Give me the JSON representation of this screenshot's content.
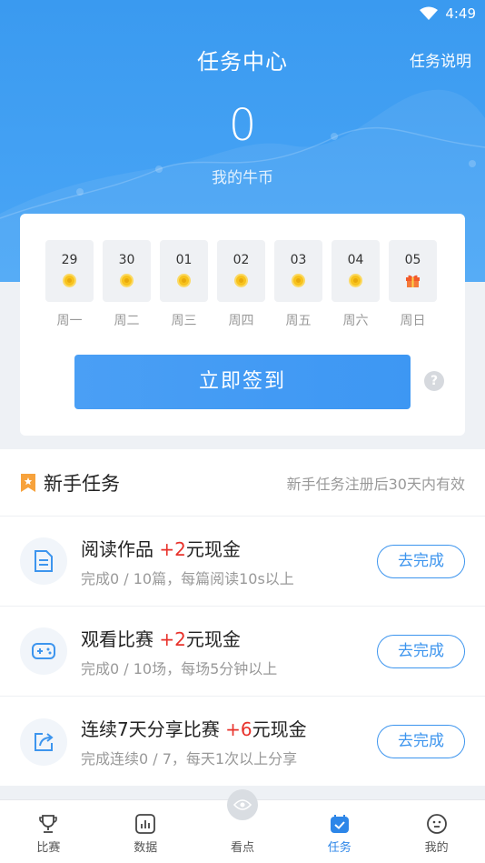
{
  "status_bar": {
    "time": "4:49"
  },
  "header": {
    "title": "任务中心",
    "task_desc_link": "任务说明",
    "coin_value": "0",
    "coin_label": "我的牛币"
  },
  "checkin": {
    "days": [
      {
        "num": "29",
        "weekday": "周一",
        "reward": "coin"
      },
      {
        "num": "30",
        "weekday": "周二",
        "reward": "coin"
      },
      {
        "num": "01",
        "weekday": "周三",
        "reward": "coin"
      },
      {
        "num": "02",
        "weekday": "周四",
        "reward": "coin"
      },
      {
        "num": "03",
        "weekday": "周五",
        "reward": "coin"
      },
      {
        "num": "04",
        "weekday": "周六",
        "reward": "coin"
      },
      {
        "num": "05",
        "weekday": "周日",
        "reward": "gift"
      }
    ],
    "sign_button": "立即签到",
    "help": "?"
  },
  "tasks": {
    "title": "新手任务",
    "note": "新手任务注册后30天内有效",
    "items": [
      {
        "name_pre": "阅读作品 ",
        "plus": "+2",
        "name_post": "元现金",
        "sub": "完成0 / 10篇，每篇阅读10s以上",
        "button": "去完成",
        "icon": "document-icon"
      },
      {
        "name_pre": "观看比赛 ",
        "plus": "+2",
        "name_post": "元现金",
        "sub": "完成0 / 10场，每场5分钟以上",
        "button": "去完成",
        "icon": "gamepad-icon"
      },
      {
        "name_pre": "连续7天分享比赛 ",
        "plus": "+6",
        "name_post": "元现金",
        "sub": "完成连续0 / 7，每天1次以上分享",
        "button": "去完成",
        "icon": "share-icon"
      }
    ]
  },
  "tabbar": {
    "tabs": [
      {
        "label": "比赛",
        "icon": "trophy-icon"
      },
      {
        "label": "数据",
        "icon": "chart-icon"
      },
      {
        "label": "看点",
        "icon": "eye-icon"
      },
      {
        "label": "任务",
        "icon": "task-icon",
        "active": true
      },
      {
        "label": "我的",
        "icon": "profile-icon"
      }
    ]
  },
  "colors": {
    "primary": "#3d95ee",
    "header": "#3a9af0",
    "reward": "#e8322b"
  }
}
